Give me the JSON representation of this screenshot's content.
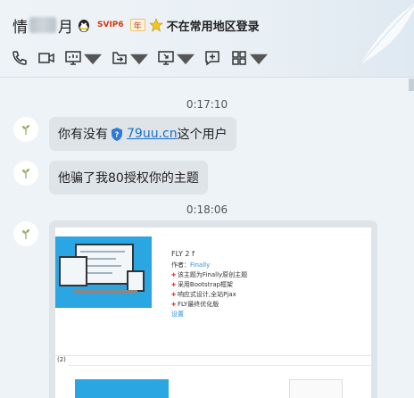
{
  "header": {
    "contact_name_start": "情",
    "contact_name_end": "月",
    "svip_badge": "SVIP6",
    "year_badge": "年",
    "region_warning": "不在常用地区登录"
  },
  "toolbar": {
    "items": [
      "phone-icon",
      "video-icon",
      "screen-share-icon",
      "transfer-file-icon",
      "remote-assist-icon",
      "message-icon",
      "apps-icon"
    ]
  },
  "messages": [
    {
      "timestamp": "0:17:10"
    },
    {
      "text_before": "你有没有",
      "link": "79uu.cn",
      "text_after": "这个用户"
    },
    {
      "text": "他骗了我80授权你的主题"
    },
    {
      "timestamp": "0:18:06"
    }
  ],
  "screenshot_card": {
    "title": "FLY 2 f",
    "author_label": "作者：",
    "author_name": "Finally",
    "features": [
      "该主题为Finally原创主题",
      "采用Bootstrap框架",
      "响应式设计,全站Pjax",
      "FLY最终优化版"
    ],
    "settings_link": "设置",
    "tab_label": "(2)"
  },
  "colors": {
    "accent": "#2aa6e3",
    "bubble": "#dfe4e8",
    "link": "#1a6fc6"
  }
}
